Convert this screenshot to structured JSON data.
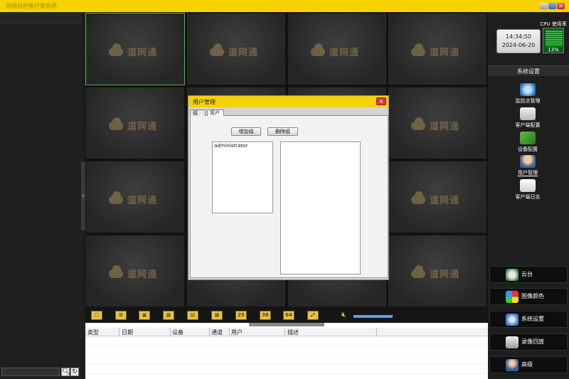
{
  "app": {
    "title": "视频监控客户端系统"
  },
  "left": {
    "search_placeholder": "",
    "search_icon": "search-icon",
    "refresh_icon": "refresh-icon"
  },
  "grid": {
    "watermark": "道网通",
    "cells": 16,
    "selected_cell": 0
  },
  "layout_toolbar": {
    "buttons": [
      "1",
      "4",
      "6",
      "9",
      "8",
      "16",
      "25",
      "36",
      "64",
      "full"
    ],
    "volume_icon": "speaker-muted-icon"
  },
  "log_table": {
    "columns": [
      "类型",
      "日期",
      "设备",
      "通道",
      "用户",
      "描述"
    ]
  },
  "status": {
    "time": "14:34:50",
    "date": "2024-06-20",
    "cpu_label": "CPU 使用率",
    "cpu_percent": "13%"
  },
  "sidebar": {
    "header": "系统设置",
    "items": [
      {
        "label": "监控点管理",
        "icon": "camera-icon"
      },
      {
        "label": "客户端配置",
        "icon": "computer-config-icon"
      },
      {
        "label": "设备配置",
        "icon": "tools-icon"
      },
      {
        "label": "用户管理",
        "icon": "user-icon"
      },
      {
        "label": "客户端日志",
        "icon": "log-icon"
      }
    ]
  },
  "bottom_buttons": [
    {
      "label": "云台",
      "icon": "ptz-icon"
    },
    {
      "label": "图像颜色",
      "icon": "color-icon"
    },
    {
      "label": "系统设置",
      "icon": "settings-gear-icon"
    },
    {
      "label": "录像回放",
      "icon": "playback-icon"
    },
    {
      "label": "高级",
      "icon": "advanced-users-icon"
    }
  ],
  "dialog": {
    "title": "用户管理",
    "tabs": [
      "组",
      "用户"
    ],
    "add_group": "增加组",
    "delete_group": "删除组",
    "groups": [
      "administrator"
    ],
    "members": []
  },
  "colors": {
    "accent_yellow": "#f6d200",
    "selected_border": "#3fbf3f",
    "cpu_green": "#2fc23c"
  }
}
